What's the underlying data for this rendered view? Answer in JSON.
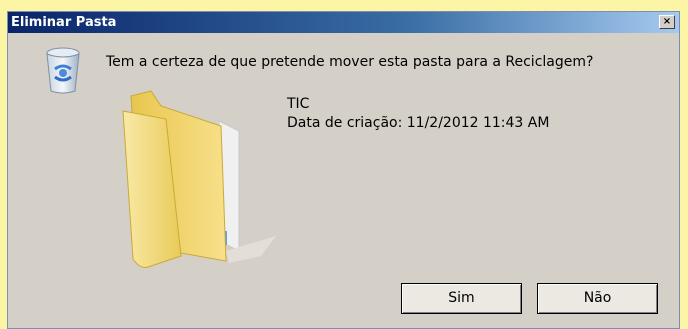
{
  "dialog": {
    "title": "Eliminar Pasta",
    "close_glyph": "×",
    "question": "Tem a certeza de que pretende mover esta pasta para a Reciclagem?",
    "item_name": "TIC",
    "item_date": "Data de criação: 11/2/2012 11:43 AM",
    "yes_label": "Sim",
    "no_label": "Não",
    "icons": [
      "recycle-bin-icon",
      "folder-icon",
      "close-icon"
    ]
  },
  "colors": {
    "background": "#fdf5a6",
    "title_bar_start": "#0a246a",
    "title_bar_end": "#a6caf0",
    "dialog_face": "#d4d0c8",
    "folder_yellow": "#f3d66a"
  }
}
